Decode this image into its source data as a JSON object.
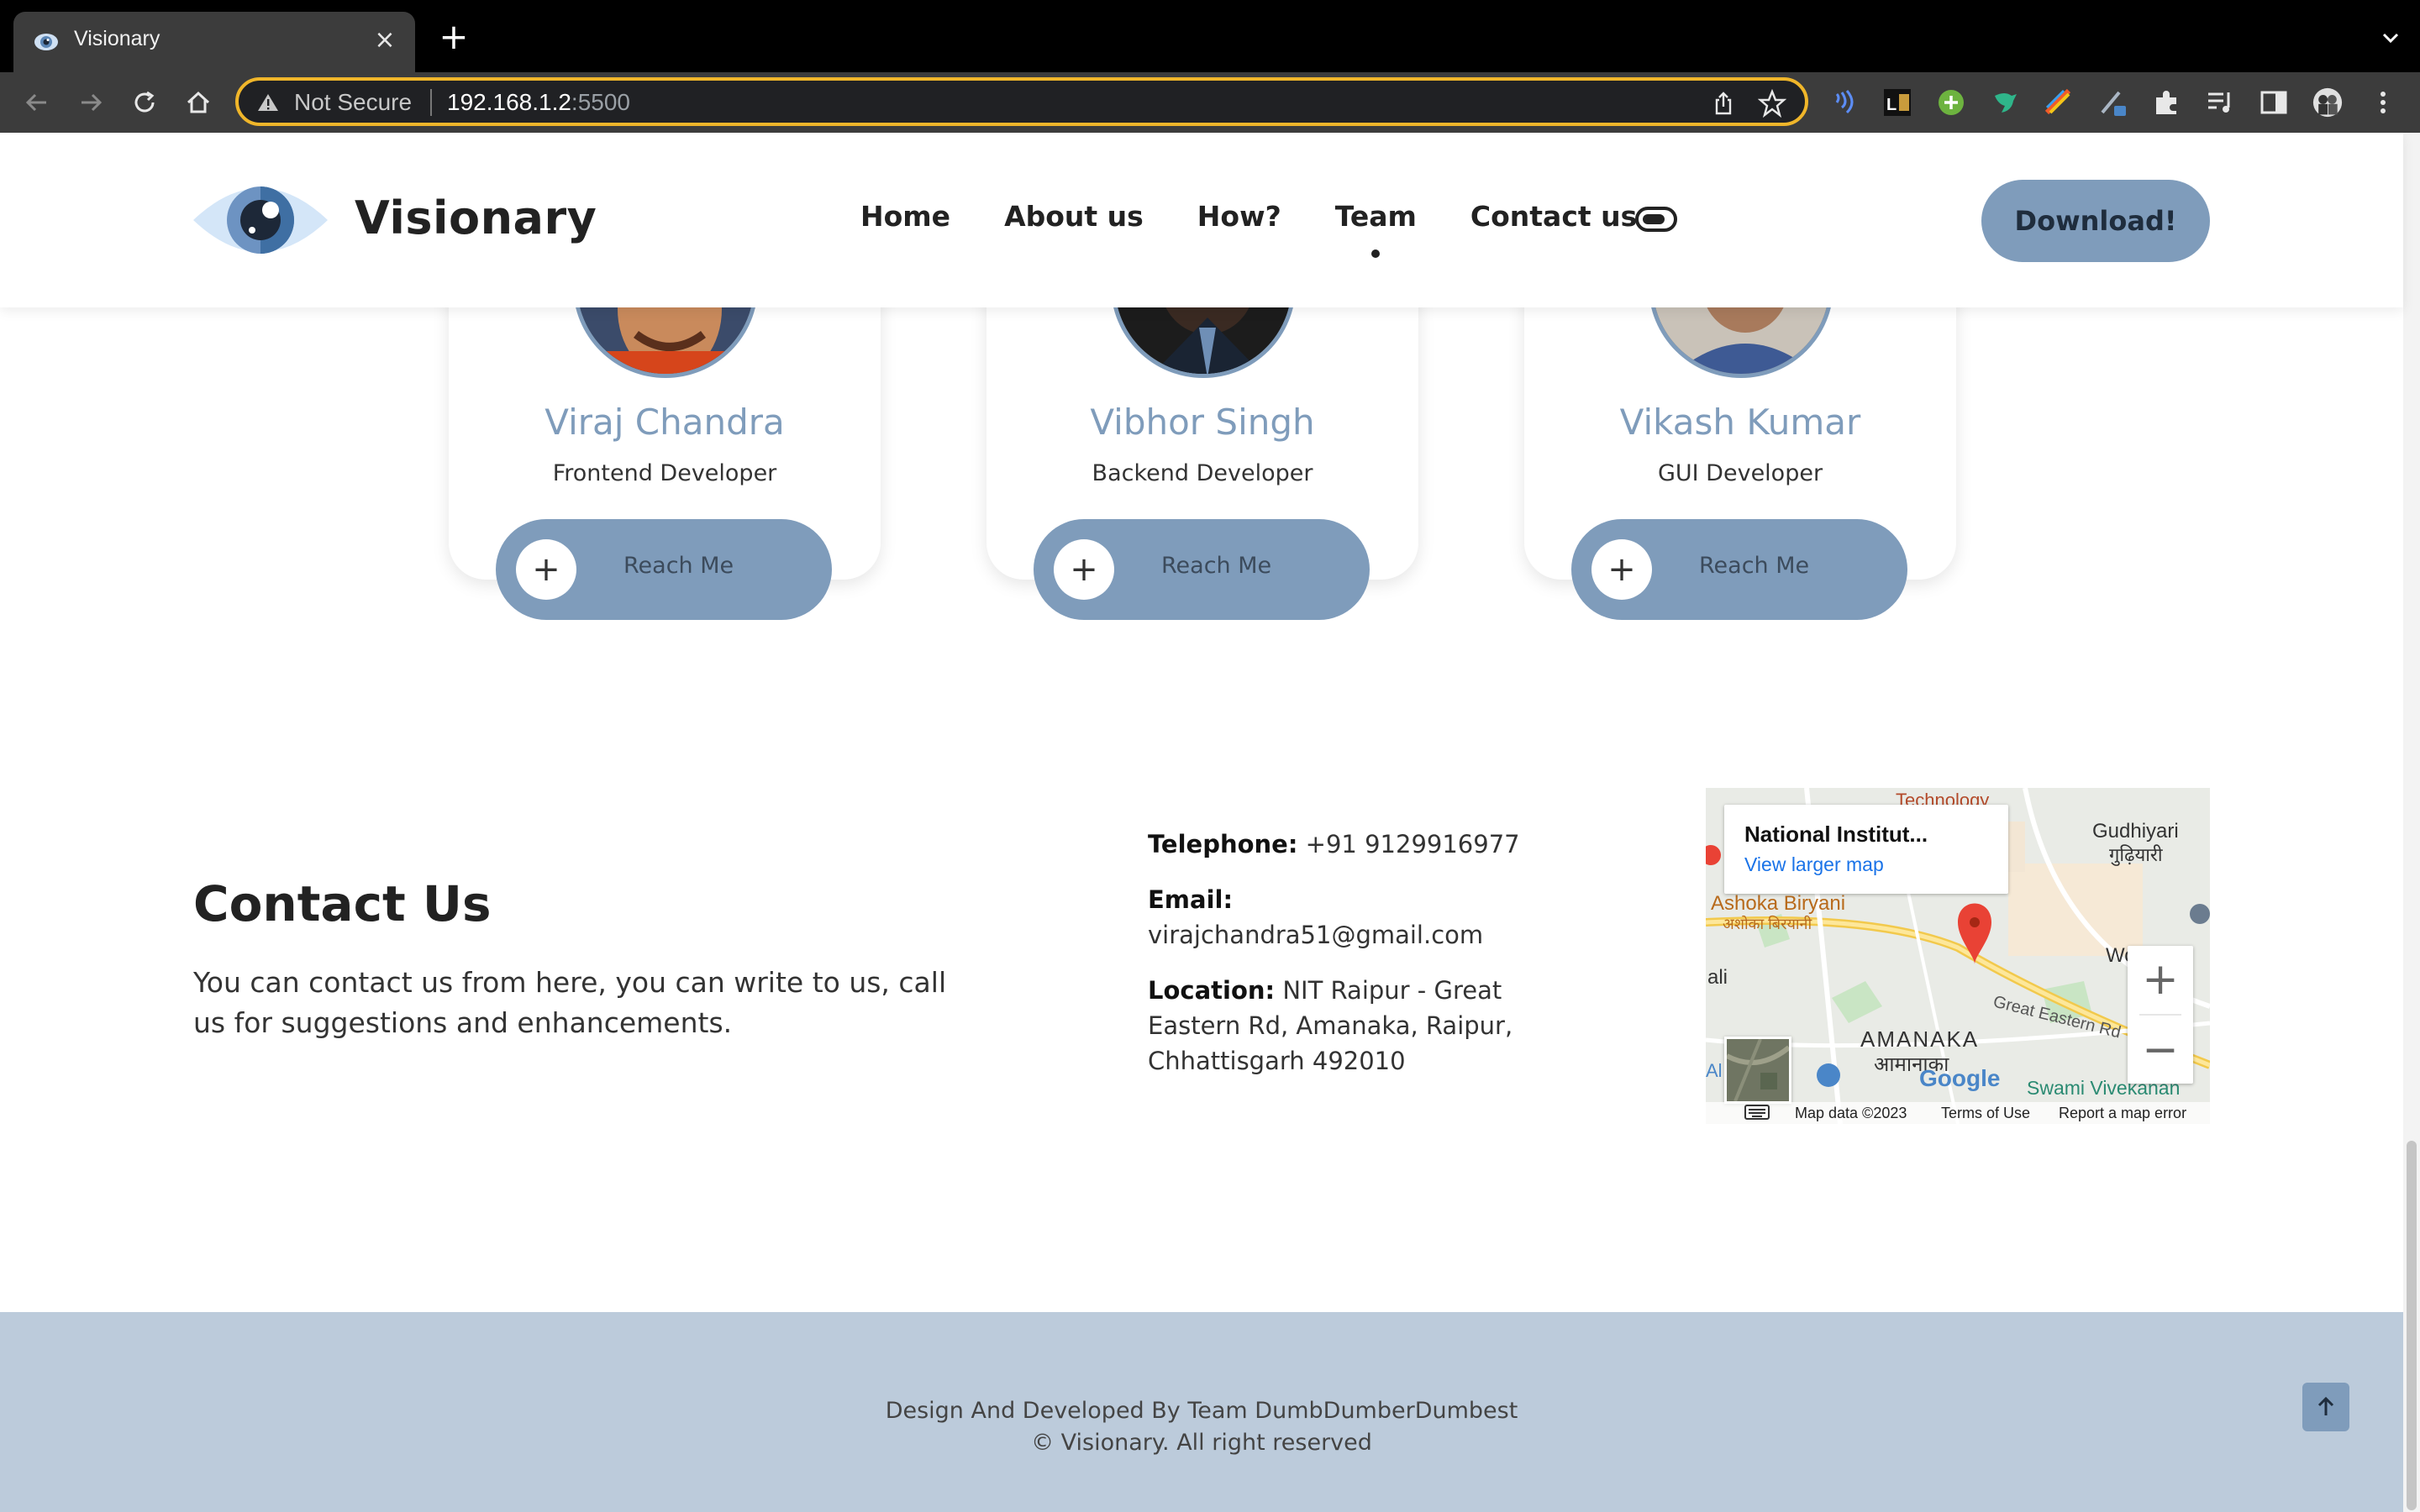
{
  "browser": {
    "tab_title": "Visionary",
    "security_label": "Not Secure",
    "url_host": "192.168.1.2",
    "url_port": ":5500"
  },
  "site": {
    "brand": "Visionary",
    "nav": [
      "Home",
      "About us",
      "How?",
      "Team",
      "Contact us"
    ],
    "active_nav": "Team",
    "download_label": "Download!"
  },
  "team": [
    {
      "name": "Viraj Chandra",
      "role": "Frontend Developer",
      "button": "Reach Me"
    },
    {
      "name": "Vibhor Singh",
      "role": "Backend Developer",
      "button": "Reach Me"
    },
    {
      "name": "Vikash Kumar",
      "role": "GUI Developer",
      "button": "Reach Me"
    }
  ],
  "contact": {
    "title": "Contact Us",
    "description": "You can contact us from here, you can write to us, call us for suggestions and enhancements.",
    "telephone_label": "Telephone:",
    "telephone": "+91 9129916977",
    "email_label": "Email:",
    "email": "virajchandra51@gmail.com",
    "location_label": "Location:",
    "location": "NIT Raipur - Great Eastern Rd, Amanaka, Raipur, Chhattisgarh 492010"
  },
  "map": {
    "place_title": "National Institut...",
    "larger_map_link": "View larger map",
    "labels": [
      "Technology",
      "Gudhiyari",
      "गुढ़ियारी",
      "Ashoka Biryani",
      "अशोका बिरयानी",
      "AMANAKA",
      "आमानाका",
      "Great Eastern Rd",
      "Swami Vivekanan",
      "Wor",
      "ali",
      "Al",
      "Google"
    ],
    "footer": [
      "Map data ©2023",
      "Terms of Use",
      "Report a map error"
    ],
    "zoom_in": "+",
    "zoom_out": "−"
  },
  "footer": {
    "credit": "Design And Developed By Team DumbDumberDumbest",
    "copyright": "© Visionary. All right reserved"
  },
  "colors": {
    "accent": "#7f9cbb",
    "footer_bg": "#bccbdb",
    "omnibox_border": "#f0b62a"
  }
}
